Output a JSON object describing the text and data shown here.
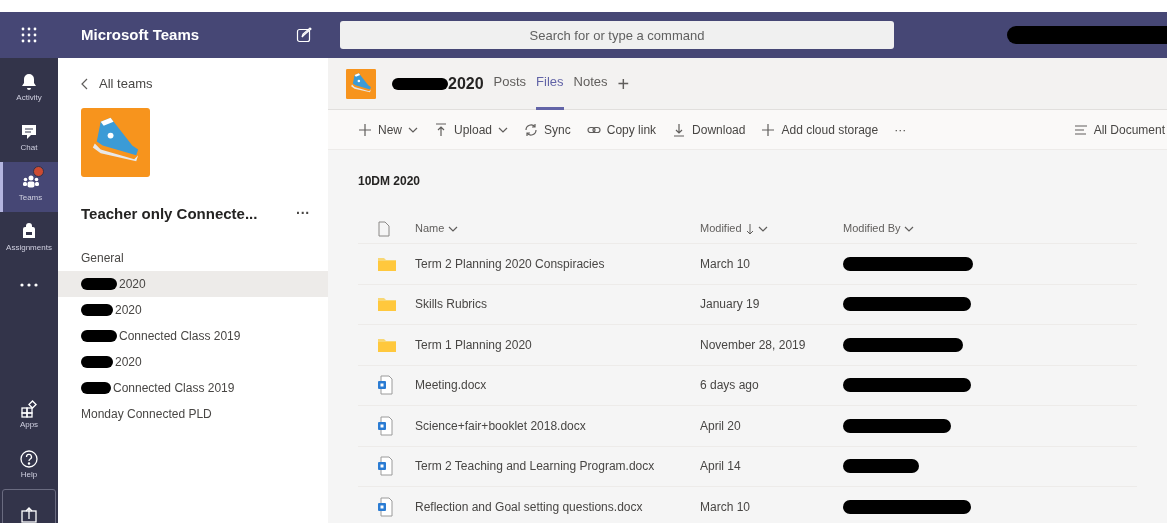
{
  "app": {
    "title": "Microsoft Teams",
    "search": {
      "placeholder": "Search for or type a command"
    },
    "account_redacted": true
  },
  "rail": [
    {
      "kind": "bell",
      "label": "Activity",
      "selected": false
    },
    {
      "kind": "chat",
      "label": "Chat",
      "selected": false
    },
    {
      "kind": "teams",
      "label": "Teams",
      "selected": true,
      "badge": true
    },
    {
      "kind": "bag",
      "label": "Assignments",
      "selected": false
    },
    {
      "kind": "more",
      "selected": false
    },
    {
      "kind": "spacer"
    },
    {
      "kind": "apps",
      "label": "Apps",
      "selected": false
    },
    {
      "kind": "help",
      "label": "Help",
      "selected": false
    },
    {
      "kind": "upload",
      "selected": false
    }
  ],
  "team_panel": {
    "back": "All teams",
    "team_name": "Teacher only Connecte...",
    "more": "···",
    "channels": [
      {
        "label": "General",
        "redacted": false,
        "selected": false
      },
      {
        "label": "2020",
        "redacted": true,
        "selected": true
      },
      {
        "label": "2020",
        "redacted": true,
        "selected": false
      },
      {
        "label": "Connected Class 2019",
        "redacted": true,
        "selected": false
      },
      {
        "label": "2020",
        "redacted": true,
        "selected": false
      },
      {
        "label": "Connected Class 2019",
        "redacted": true,
        "selected": false
      },
      {
        "label": "Monday Connected PLD",
        "redacted": false,
        "selected": false
      }
    ]
  },
  "channel_header": {
    "title": "2020",
    "title_redacted": true,
    "tabs": [
      {
        "label": "Posts",
        "selected": false
      },
      {
        "label": "Files",
        "selected": true
      },
      {
        "label": "Notes",
        "selected": false
      }
    ],
    "add_tab": "+"
  },
  "toolbar": [
    {
      "kind": "plus",
      "label": "New",
      "caret": true
    },
    {
      "kind": "upload",
      "label": "Upload",
      "caret": true
    },
    {
      "kind": "sync",
      "label": "Sync",
      "caret": false
    },
    {
      "kind": "link",
      "label": "Copy link",
      "caret": false
    },
    {
      "kind": "download",
      "label": "Download",
      "caret": false
    },
    {
      "kind": "plus",
      "label": "Add cloud storage",
      "caret": false
    },
    {
      "kind": "more",
      "label": "···",
      "caret": false
    }
  ],
  "view_label": "All Document",
  "breadcrumb": "10DM 2020",
  "table": {
    "columns": [
      {
        "label": "Name",
        "sorted": false
      },
      {
        "label": "Modified",
        "sorted": true
      },
      {
        "label": "Modified By",
        "sorted": false
      }
    ],
    "rows": [
      {
        "kind": "folder",
        "name": "Term 2 Planning 2020 Conspiracies",
        "modified": "March 10",
        "modified_by_redacted": true
      },
      {
        "kind": "folder",
        "name": "Skills Rubrics",
        "modified": "January 19",
        "modified_by_redacted": true
      },
      {
        "kind": "folder",
        "name": "Term 1 Planning 2020",
        "modified": "November 28, 2019",
        "modified_by_redacted": true
      },
      {
        "kind": "doc",
        "name": "Meeting.docx",
        "modified": "6 days ago",
        "modified_by_redacted": true
      },
      {
        "kind": "doc",
        "name": "Science+fair+booklet 2018.docx",
        "modified": "April 20",
        "modified_by_redacted": true
      },
      {
        "kind": "doc",
        "name": "Term 2 Teaching and Learning Program.docx",
        "modified": "April 14",
        "modified_by_redacted": true
      },
      {
        "kind": "doc",
        "name": "Reflection and Goal setting questions.docx",
        "modified": "March 10",
        "modified_by_redacted": true
      }
    ]
  }
}
